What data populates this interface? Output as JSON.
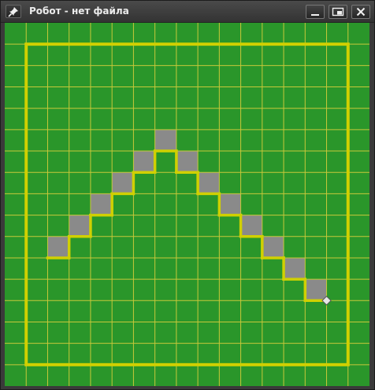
{
  "window": {
    "title": "Робот - нет файла",
    "icons": {
      "pin": "pin-icon",
      "minimize": "minimize-icon",
      "restore": "restore-icon",
      "close": "close-icon"
    }
  },
  "field": {
    "columns": 17,
    "rows": 17,
    "colors": {
      "background": "#2a962a",
      "grid": "#c8c83a",
      "wall": "#d0d000",
      "painted_cell": "#8a8a8a",
      "robot": "#e6e6e6"
    },
    "wall_box": {
      "col_from": 1,
      "col_to": 16,
      "row_from": 1,
      "row_to": 16
    },
    "painted_cells": [
      [
        2,
        10
      ],
      [
        3,
        9
      ],
      [
        4,
        8
      ],
      [
        5,
        7
      ],
      [
        6,
        6
      ],
      [
        7,
        5
      ],
      [
        8,
        6
      ],
      [
        9,
        7
      ],
      [
        10,
        8
      ],
      [
        11,
        9
      ],
      [
        12,
        10
      ],
      [
        13,
        11
      ],
      [
        14,
        12
      ]
    ],
    "robot": {
      "col": 15,
      "row": 13
    }
  }
}
